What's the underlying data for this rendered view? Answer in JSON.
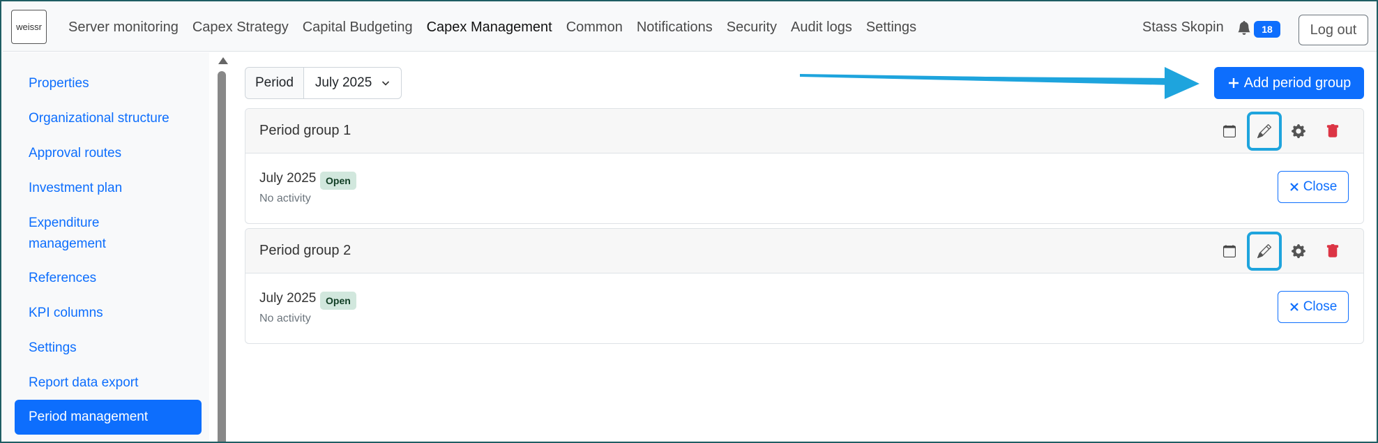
{
  "app": {
    "logo_text": "weissr"
  },
  "nav": {
    "links": [
      "Server monitoring",
      "Capex Strategy",
      "Capital Budgeting",
      "Capex Management",
      "Common",
      "Notifications",
      "Security",
      "Audit logs",
      "Settings"
    ],
    "active": "Capex Management",
    "user_name": "Stass Skopin",
    "notification_count": "18",
    "logout_label": "Log out"
  },
  "sidebar": {
    "items": [
      "Properties",
      "Organizational structure",
      "Approval routes",
      "Investment plan",
      "Expenditure management",
      "References",
      "KPI columns",
      "Settings",
      "Report data export",
      "Period management"
    ],
    "active": "Period management"
  },
  "main": {
    "period_label": "Period",
    "period_value": "July 2025",
    "add_button_label": "Add period group",
    "close_label": "Close",
    "groups": [
      {
        "title": "Period group 1",
        "period": "July 2025",
        "status": "Open",
        "activity": "No activity"
      },
      {
        "title": "Period group 2",
        "period": "July 2025",
        "status": "Open",
        "activity": "No activity"
      }
    ]
  },
  "colors": {
    "primary": "#0d6efd",
    "danger": "#dc3545",
    "highlight": "#1ea4dd",
    "badge_bg": "#d1e7dd"
  }
}
